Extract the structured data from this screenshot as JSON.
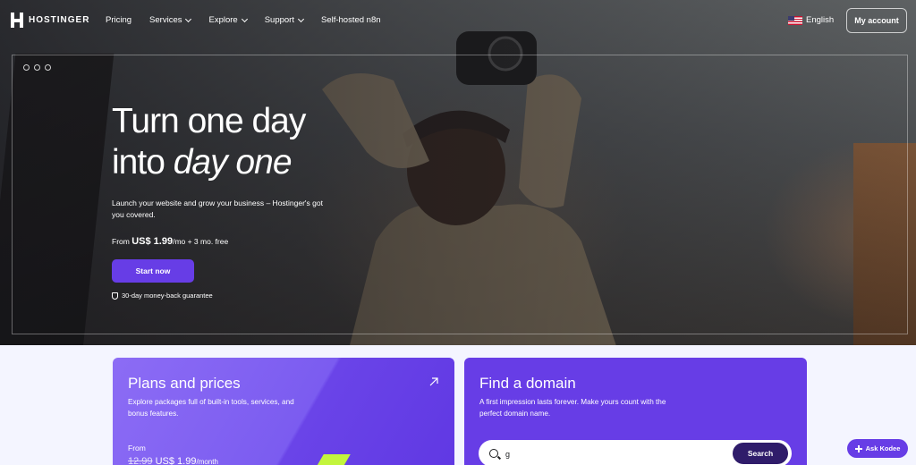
{
  "nav": {
    "brand": "HOSTINGER",
    "items": [
      {
        "label": "Pricing",
        "dropdown": false
      },
      {
        "label": "Services",
        "dropdown": true
      },
      {
        "label": "Explore",
        "dropdown": true
      },
      {
        "label": "Support",
        "dropdown": true
      },
      {
        "label": "Self-hosted n8n",
        "dropdown": false
      }
    ],
    "language": "English",
    "language_icon": "us-flag-icon",
    "account": "My account"
  },
  "hero": {
    "title_line1": "Turn one day",
    "title_line2_prefix": "into ",
    "title_line2_emphasis": "day one",
    "subtitle": "Launch your website and grow your business – Hostinger's got you covered.",
    "price_prefix": "From ",
    "price_value": "US$ 1.99",
    "price_suffix": "/mo + 3 mo. free",
    "cta": "Start now",
    "guarantee": "30-day money-back guarantee",
    "carousel_dots": 3
  },
  "cards": {
    "plans": {
      "title": "Plans and prices",
      "description": "Explore packages full of built-in tools, services, and bonus features.",
      "from_label": "From",
      "old_price": "12.99",
      "new_price": "US$ 1.99",
      "unit": "/month",
      "icon": "arrow-up-right-icon"
    },
    "domain": {
      "title": "Find a domain",
      "description": "A first impression lasts forever. Make yours count with the perfect domain name.",
      "search_value": "g",
      "search_button": "Search",
      "icon": "search-icon"
    }
  },
  "assistant": {
    "label": "Ask Kodee",
    "icon": "sparkle-icon"
  },
  "colors": {
    "primary": "#673de6",
    "search_button": "#2f1c6a",
    "accent_green": "#c3f53c",
    "page_bg": "#f4f5ff"
  }
}
